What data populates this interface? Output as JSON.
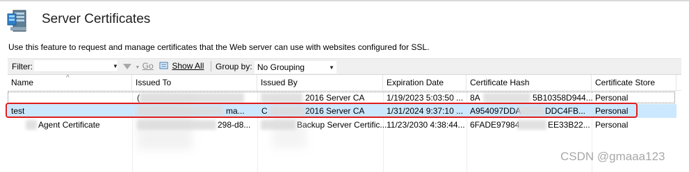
{
  "header": {
    "title": "Server Certificates",
    "icon": "server-icon"
  },
  "description": "Use this feature to request and manage certificates that the Web server can use with websites configured for SSL.",
  "toolbar": {
    "filter_label": "Filter:",
    "filter_value": "",
    "go_label": "Go",
    "show_all_label": "Show All",
    "group_by_label": "Group by:",
    "group_by_value": "No Grouping"
  },
  "table": {
    "columns": [
      "Name",
      "Issued To",
      "Issued By",
      "Expiration Date",
      "Certificate Hash",
      "Certificate Store"
    ],
    "rows": [
      {
        "name": "",
        "issued_to": "(",
        "issued_by": "2016 Server CA",
        "expiration": "1/19/2023 5:03:50 ...",
        "hash_a": "8A",
        "hash_b": "5B10358D944...",
        "store": "Personal",
        "selected": false
      },
      {
        "name": "test",
        "issued_to": "ma...",
        "issued_by_prefix": "C",
        "issued_by": "2016 Server CA",
        "expiration": "1/31/2024 9:37:10 ...",
        "hash_a": "A954097DDA",
        "hash_b": "DDC4FB...",
        "store": "Personal",
        "selected": true
      },
      {
        "name": "Agent Certificate",
        "issued_to": "298-d8...",
        "issued_by": "Backup Server Certific...",
        "expiration": "11/23/2030 4:38:44...",
        "hash_a": "6FADE97984",
        "hash_b": "EE33B22...",
        "store": "Personal",
        "selected": false
      }
    ]
  },
  "watermark": "CSDN @gmaaa123",
  "colors": {
    "selection": "#cce8ff",
    "highlight_box": "#e01c1c"
  }
}
